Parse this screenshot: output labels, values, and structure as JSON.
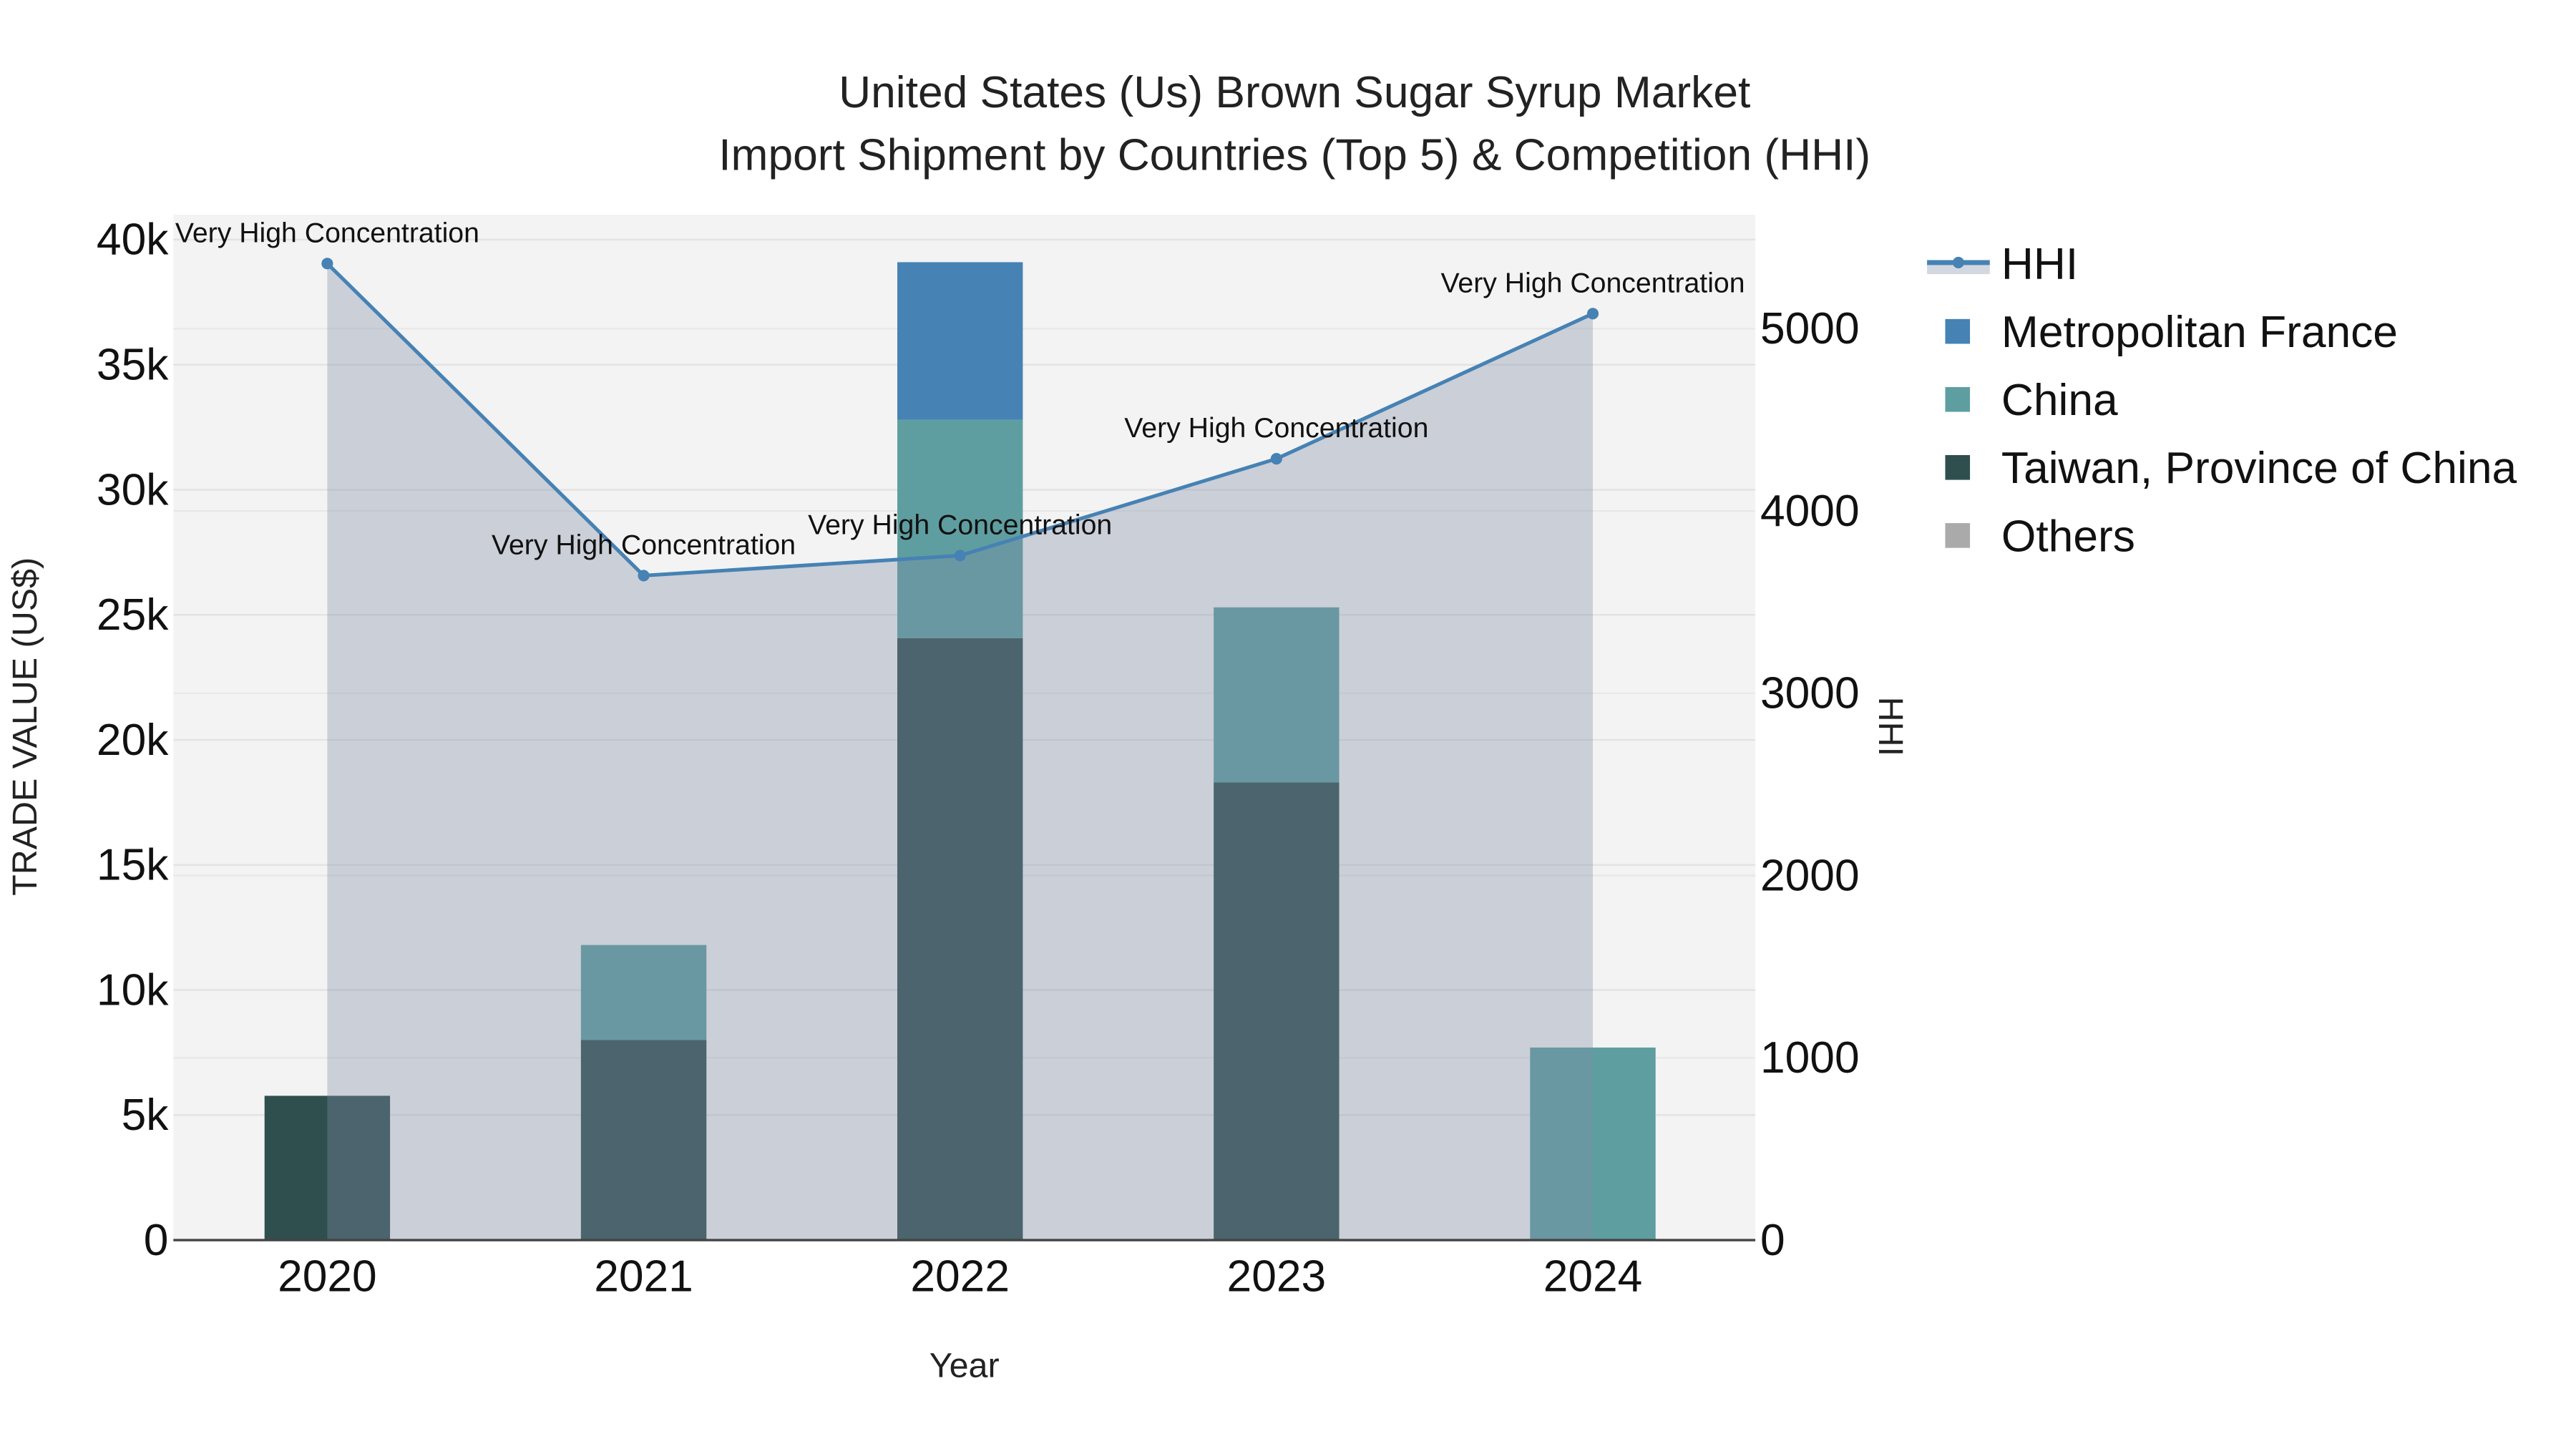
{
  "chart_data": {
    "type": "bar",
    "title": "United States (Us) Brown Sugar Syrup Market",
    "subtitle": "Import Shipment by Countries (Top 5) & Competition (HHI)",
    "xlabel": "Year",
    "ylabel": "TRADE VALUE (US$)",
    "y2label": "HHI",
    "categories": [
      "2020",
      "2021",
      "2022",
      "2023",
      "2024"
    ],
    "ylim": [
      0,
      41000
    ],
    "y2lim": [
      0,
      5625
    ],
    "yticks": [
      0,
      5000,
      10000,
      15000,
      20000,
      25000,
      30000,
      35000,
      40000
    ],
    "ytick_labels": [
      "0",
      "5k",
      "10k",
      "15k",
      "20k",
      "25k",
      "30k",
      "35k",
      "40k"
    ],
    "y2ticks": [
      0,
      1000,
      2000,
      3000,
      4000,
      5000
    ],
    "y2tick_labels": [
      "0",
      "1000",
      "2000",
      "3000",
      "4000",
      "5000"
    ],
    "barmode": "stack",
    "series": [
      {
        "name": "Taiwan, Province of China",
        "color": "#2f4f4f",
        "values": [
          5770,
          8000,
          24070,
          18300,
          0
        ]
      },
      {
        "name": "China",
        "color": "#5f9ea0",
        "values": [
          0,
          3800,
          8730,
          7000,
          7700
        ]
      },
      {
        "name": "Metropolitan France",
        "color": "#4682b4",
        "values": [
          0,
          0,
          6300,
          0,
          0
        ]
      },
      {
        "name": "Others",
        "color": "#aaaaaa",
        "values": [
          0,
          0,
          0,
          0,
          0
        ]
      }
    ],
    "hhi": {
      "name": "HHI",
      "color": "#4682b4",
      "values": [
        5357,
        3645,
        3755,
        4286,
        5082
      ],
      "annotations": [
        "Very High Concentration",
        "Very High Concentration",
        "Very High Concentration",
        "Very High Concentration",
        "Very High Concentration"
      ]
    },
    "legend": [
      "HHI",
      "Metropolitan France",
      "China",
      "Taiwan, Province of China",
      "Others"
    ],
    "legend_position": "right",
    "grid": true
  }
}
